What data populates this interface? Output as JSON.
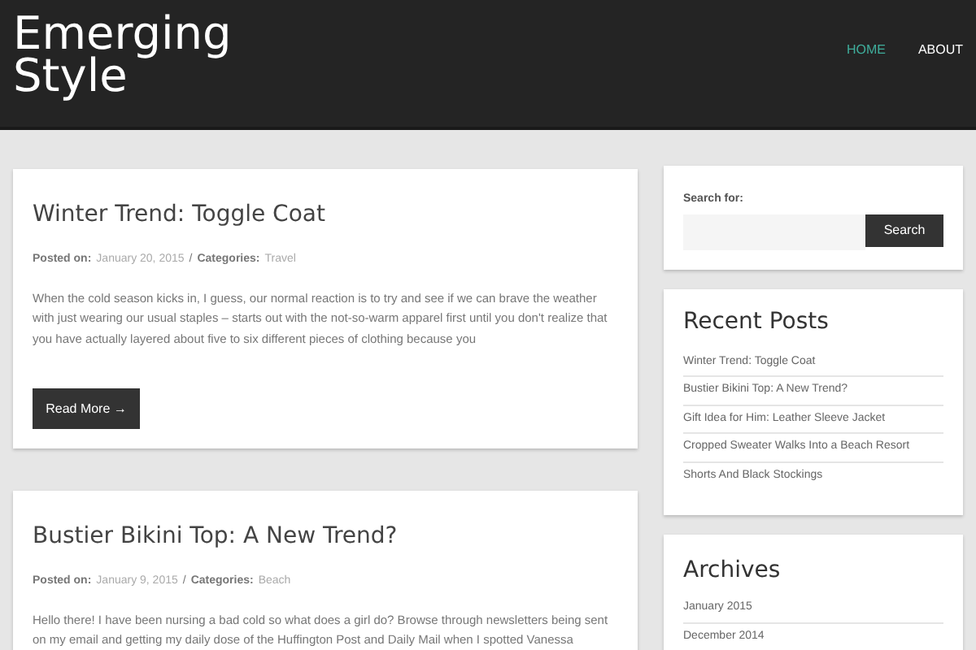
{
  "site_title": "Emerging Style",
  "nav": [
    {
      "label": "HOME",
      "selected": true
    },
    {
      "label": "ABOUT",
      "selected": false
    }
  ],
  "posts": [
    {
      "title": "Winter Trend: Toggle Coat",
      "posted_label": "Posted on:",
      "date": "January 20, 2015",
      "separator": "/",
      "categories_label": "Categories:",
      "category": "Travel",
      "excerpt": "When the cold season kicks in, I guess, our normal reaction is to try and see if we can brave the weather with just wearing our usual staples – starts out with the not-so-warm apparel first until you don't realize that you have actually layered about five to six different pieces of clothing because you",
      "button": "Read More →"
    },
    {
      "title": "Bustier Bikini Top: A New Trend?",
      "posted_label": "Posted on:",
      "date": "January 9, 2015",
      "separator": "/",
      "categories_label": "Categories:",
      "category": "Beach",
      "excerpt": "Hello there! I have been nursing a bad cold so what does a girl do? Browse through newsletters being sent on my email and getting my daily dose of the Huffington Post and Daily Mail when I spotted Vanessa"
    }
  ],
  "search": {
    "label": "Search for:",
    "button": "Search"
  },
  "recent_posts": {
    "title": "Recent Posts",
    "items": [
      "Winter Trend: Toggle Coat",
      "Bustier Bikini Top: A New Trend?",
      "Gift Idea for Him: Leather Sleeve Jacket",
      "Cropped Sweater Walks Into a Beach Resort",
      "Shorts And Black Stockings"
    ]
  },
  "archives": {
    "title": "Archives",
    "items": [
      "January 2015",
      "December 2014"
    ]
  }
}
